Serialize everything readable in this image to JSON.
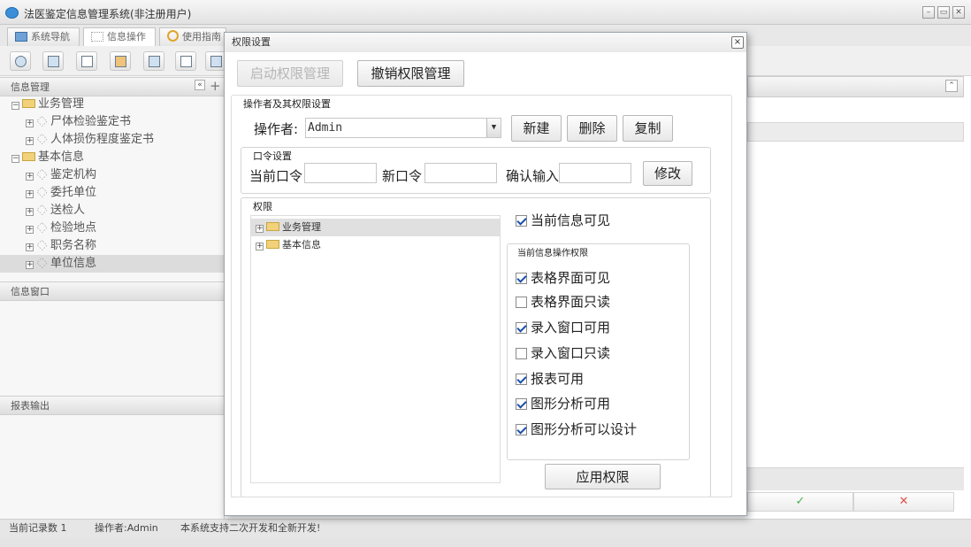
{
  "window": {
    "title": "法医鉴定信息管理系统(非注册用户)"
  },
  "tabs": [
    {
      "label": "系统导航",
      "icon": "monitor-icon"
    },
    {
      "label": "信息操作",
      "icon": "grid-icon"
    },
    {
      "label": "使用指南",
      "icon": "help-circle-icon"
    }
  ],
  "left_panel": {
    "header": "信息管理",
    "tree": [
      {
        "label": "业务管理",
        "level": 0,
        "expander": "⊟"
      },
      {
        "label": "尸体检验鉴定书",
        "level": 1,
        "expander": "⊞"
      },
      {
        "label": "人体损伤程度鉴定书",
        "level": 1,
        "expander": "⊞"
      },
      {
        "label": "基本信息",
        "level": 0,
        "expander": "⊟"
      },
      {
        "label": "鉴定机构",
        "level": 1,
        "expander": "⊞"
      },
      {
        "label": "委托单位",
        "level": 1,
        "expander": "⊞"
      },
      {
        "label": "送检人",
        "level": 1,
        "expander": "⊞"
      },
      {
        "label": "检验地点",
        "level": 1,
        "expander": "⊞"
      },
      {
        "label": "职务名称",
        "level": 1,
        "expander": "⊞"
      },
      {
        "label": "单位信息",
        "level": 1,
        "expander": "⊞",
        "selected": true
      }
    ],
    "info_window": "信息窗口",
    "report_output": "报表输出"
  },
  "statusbar": {
    "record_count": "当前记录数 1",
    "operator": "操作者:Admin",
    "note": "本系统支持二次开发和全新开发!"
  },
  "dialog": {
    "title": "权限设置",
    "close": "×",
    "enable_button": "启动权限管理",
    "revoke_button": "撤销权限管理",
    "operator_section": {
      "legend": "操作者及其权限设置",
      "operator_label": "操作者:",
      "operator_value": "Admin",
      "new_button": "新建",
      "delete_button": "删除",
      "copy_button": "复制"
    },
    "password_section": {
      "legend": "口令设置",
      "current_label": "当前口令",
      "new_label": "新口令",
      "confirm_label": "确认输入",
      "modify_button": "修改"
    },
    "permission_section": {
      "legend": "权限",
      "tree": [
        "业务管理",
        "基本信息"
      ],
      "visible_label": "当前信息可见",
      "visible_checked": true,
      "ops_legend": "当前信息操作权限",
      "ops": [
        {
          "label": "表格界面可见",
          "checked": true
        },
        {
          "label": "表格界面只读",
          "checked": false
        },
        {
          "label": "录入窗口可用",
          "checked": true
        },
        {
          "label": "录入窗口只读",
          "checked": false
        },
        {
          "label": "报表可用",
          "checked": true
        },
        {
          "label": "图形分析可用",
          "checked": true
        },
        {
          "label": "图形分析可以设计",
          "checked": true
        }
      ],
      "apply_button": "应用权限"
    }
  },
  "background_grid": {
    "confirm_icon": "✓",
    "cancel_icon": "✕"
  },
  "colors": {
    "selection": "#dcdcdc",
    "check": "#1a4fa8",
    "confirm": "#4caf50",
    "cancel": "#e05050"
  }
}
